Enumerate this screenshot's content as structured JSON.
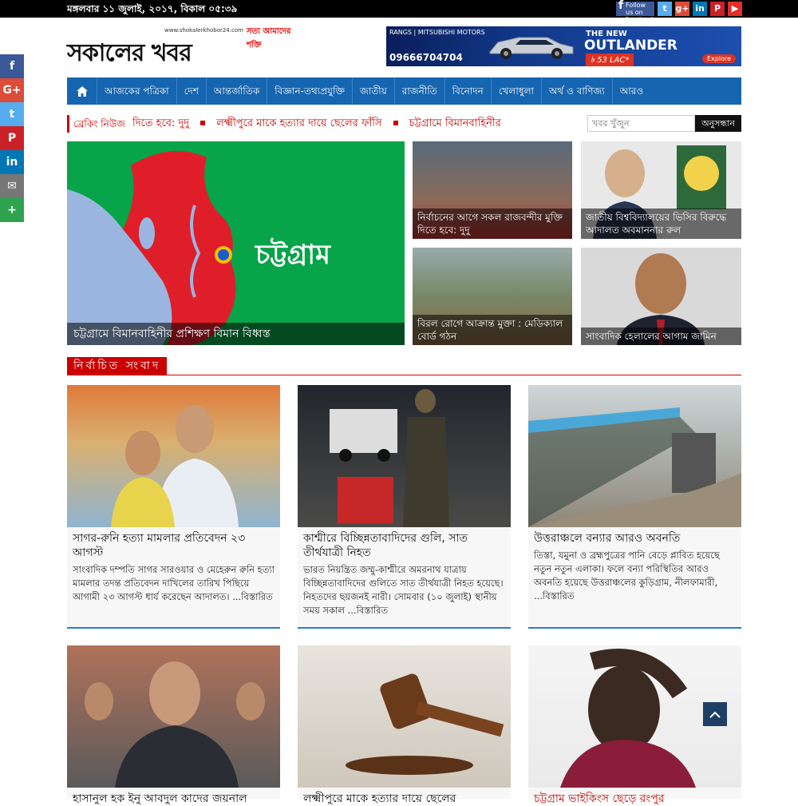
{
  "topbar": {
    "date": "মঙ্গলবার ১১ জুলাই, ২০১৭, বিকাল ০৫:৩৯",
    "social": {
      "facebook_label": "Follow us on facebook",
      "twitter": "twitter-icon",
      "googleplus": "googleplus-icon",
      "linkedin": "linkedin-icon",
      "pinterest": "pinterest-icon",
      "youtube": "youtube-icon"
    }
  },
  "logo": {
    "url": "www.shokalerkhobor24.com",
    "tagline": "সত্য আমাদের শক্তি",
    "name": "সকালের খবর"
  },
  "ad": {
    "brand": "RANGS | MITSUBISHI MOTORS",
    "phone": "09666704704",
    "the_new": "THE NEW",
    "model": "OUTLANDER",
    "price": "৳ 53 LAC*",
    "explore": "Explore"
  },
  "nav": {
    "home_icon": "home-icon",
    "items": [
      "আজকের পত্রিকা",
      "দেশ",
      "আন্তর্জাতিক",
      "বিজ্ঞান-তথ্যপ্রযুক্তি",
      "জাতীয়",
      "রাজনীতি",
      "বিনোদন",
      "খেলাধুলা",
      "অর্থ ও বাণিজ্য",
      "আরও"
    ]
  },
  "breaking": {
    "label": "ব্রেকিং নিউজ",
    "items": [
      "দিতে হবে: দুদু",
      "লক্ষ্মীপুরে মাকে হত্যার দায়ে ছেলের ফাঁসি",
      "চট্টগ্রামে বিমানবাহিনীর"
    ]
  },
  "search": {
    "placeholder": "খবর খুঁজুন",
    "button": "অনুসন্ধান"
  },
  "share_left": [
    "facebook-icon",
    "googleplus-icon",
    "twitter-icon",
    "pinterest-icon",
    "linkedin-icon",
    "email-icon",
    "more-icon"
  ],
  "features": {
    "big": {
      "caption": "চট্টগ্রামে বিমানবাহিনীর প্রশিক্ষণ বিমান বিধ্বস্ত",
      "map_label": "চট্টগ্রাম"
    },
    "f1": {
      "caption": "নির্বাচনের আগে সকল রাজবন্দীর মুক্তি দিতে হবে: দুদু"
    },
    "f2": {
      "caption": "জাতীয় বিশ্ববিদ্যালয়ের ভিসির বিরুদ্ধে আদালত অবমাননার রুল"
    },
    "f3": {
      "caption": "বিরল রোগে আক্রান্ত মুক্তা : মেডিক্যাল বোর্ড গঠন"
    },
    "f4": {
      "caption": "সাংবাদিক হেলালের আগাম জামিন"
    }
  },
  "section": {
    "title": "নির্বাচিত সংবাদ"
  },
  "cards": [
    {
      "title": "সাগর-রুনি হত্যা মামলার প্রতিবেদন ২৩ আগস্ট",
      "excerpt": "সাংবাদিক দম্পতি সাগর সারওয়ার ও মেহেরুন রুনি হত্যা মামলার তদন্ত প্রতিবেদন দাখিলের তারিখ পিছিয়ে আগামী ২৩ আগস্ট ধার্য করেছেন আদালত। ...বিস্তারিত"
    },
    {
      "title": "কাশ্মীরে বিচ্ছিন্নতাবাদিদের গুলি, সাত তীর্থযাত্রী নিহত",
      "excerpt": "ভারত নিয়ন্ত্রিত জম্মু-কাশ্মীরে অমরনাথ যাত্রায় বিচ্ছিন্নতাবাদিদের গুলিতে সাত তীর্থযাত্রী নিহত হয়েছে। নিহতদের ছয়জনই নারী। সোমবার (১০ জুলাই) স্থানীয় সময় সকাল ...বিস্তারিত"
    },
    {
      "title": "উত্তরাঞ্চলে বন্যার আরও অবনতি",
      "excerpt": "তিস্তা, যমুনা ও ব্রহ্মপুত্রের পানি বেড়ে প্লাবিত হয়েছে নতুন নতুন এলাকা। ফলে বন্যা পরিস্থিতির আরও অবনতি হয়েছে উত্তরাঞ্চলের কুড়িগ্রাম, নীলফামারী, ...বিস্তারিত"
    },
    {
      "title": "হাসানুল হক ইনু আবদুল কাদের জয়নাল"
    },
    {
      "title": "লক্ষ্মীপুরে মাকে হত্যার দায়ে ছেলের"
    },
    {
      "title": "চট্টগ্রাম ভাইকিংস ছেড়ে রংপুর"
    }
  ],
  "backtop": "arrow-up-icon"
}
